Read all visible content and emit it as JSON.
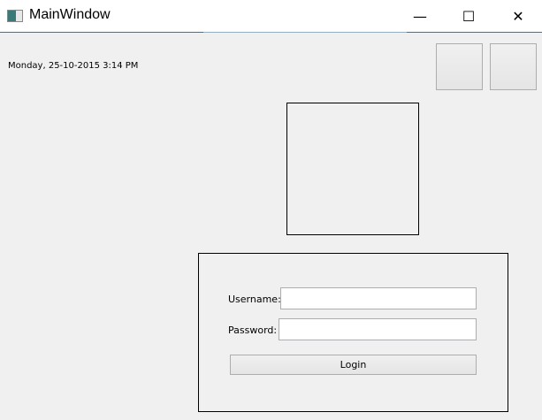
{
  "window": {
    "title": "MainWindow",
    "minimize": "—",
    "maximize": "☐",
    "close": "✕"
  },
  "datetime": "Monday, 25-10-2015 3:14 PM",
  "login": {
    "username_label": "Username:",
    "username_value": "",
    "password_label": "Password:",
    "password_value": "",
    "button": "Login"
  }
}
